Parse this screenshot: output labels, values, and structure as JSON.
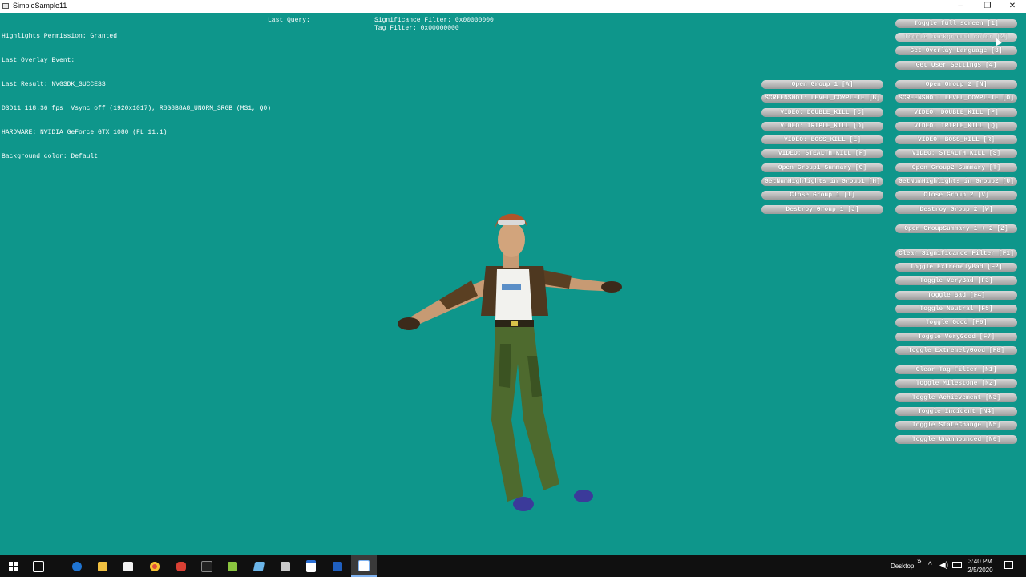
{
  "window": {
    "title": "SimpleSample11",
    "minimize": "–",
    "maximize": "❐",
    "close": "✕"
  },
  "hud": {
    "status_lines": [
      "Highlights Permission: Granted",
      "Last Overlay Event:",
      "Last Result: NVGSDK_SUCCESS",
      "D3D11 118.36 fps  Vsync off (1920x1017), R8G8B8A8_UNORM_SRGB (MS1, Q0)",
      "HARDWARE: NVIDIA GeForce GTX 1080 (FL 11.1)",
      "Background color: Default"
    ],
    "last_query": "Last Query:",
    "significance_filter": "Significance Filter: 0x00000000",
    "tag_filter": "Tag Filter: 0x00000000"
  },
  "buttons": {
    "top": [
      "Toggle full screen [1]",
      "Toggle background color [2]",
      "Get Overlay Language [3]",
      "Get User Settings [4]"
    ],
    "group1": [
      "Open Group 1 [A]",
      "SCREENSHOT: LEVEL_COMPLETE [B]",
      "VIDEO: DOUBLE_KILL [C]",
      "VIDEO: TRIPLE_KILL [D]",
      "VIDEO: BOSS_KILL [E]",
      "VIDEO: STEALTH_KILL [F]",
      "Open Group1 Summary [G]",
      "GetNumHighlights in Group1 [H]",
      "Close Group 1 [I]",
      "Destroy Group 1 [J]"
    ],
    "group2": [
      "Open Group 2 [N]",
      "SCREENSHOT: LEVEL_COMPLETE [O]",
      "VIDEO: DOUBLE_KILL [P]",
      "VIDEO: TRIPLE_KILL [Q]",
      "VIDEO: BOSS_KILL [R]",
      "VIDEO: STEALTH_KILL [S]",
      "Open Group2 Summary [T]",
      "GetNumHighlights in Group2 [U]",
      "Close Group 2 [V]",
      "Destroy Group 2 [W]"
    ],
    "summary_both": "Open GroupSummary 1 + 2 [Z]",
    "significance": [
      "Clear Significance Filter [F1]",
      "Toggle ExtremelyBad [F2]",
      "Toggle VeryBad [F3]",
      "Toggle Bad [F4]",
      "Toggle Neutral [F5]",
      "Toggle Good [F6]",
      "Toggle VeryGood [F7]",
      "Toggle ExtremelyGood [F8]"
    ],
    "tags": [
      "Clear Tag Filter [N1]",
      "Toggle Milestone [N2]",
      "Toggle Achievement [N3]",
      "Toggle Incident [N4]",
      "Toggle StateChange [N5]",
      "Toggle Unannounced [N6]"
    ]
  },
  "taskbar": {
    "start_icon": "windows-start-icon",
    "apps": [
      "task-view-icon",
      "edge-icon",
      "file-explorer-icon",
      "store-icon",
      "chrome-icon",
      "vivaldi-icon",
      "terminal-icon",
      "notepad-plus-icon",
      "app-icon",
      "app-icon",
      "window-icon",
      "powershell-icon",
      "simplesample-icon"
    ],
    "desktop_label": "Desktop",
    "chevron": "»",
    "time": "3:40 PM",
    "date": "2/5/2020"
  },
  "colors": {
    "background": "#0e968b",
    "button_top": "#d8d8d8",
    "button_bottom": "#9c9c9c",
    "taskbar": "#101010"
  }
}
